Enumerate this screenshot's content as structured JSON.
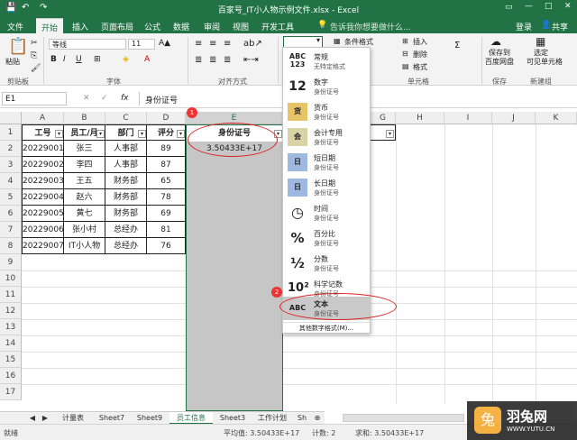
{
  "window": {
    "title": "百家号_IT小人物示例文件.xlsx - Excel"
  },
  "tabs": {
    "file": "文件",
    "home": "开始",
    "insert": "插入",
    "layout": "页面布局",
    "formula": "公式",
    "data": "数据",
    "review": "审阅",
    "view": "视图",
    "dev": "开发工具",
    "tell": "告诉我你想要做什么...",
    "login": "登录",
    "share": "共享"
  },
  "ribbon": {
    "paste": "粘贴",
    "clipboard": "剪贴板",
    "font_name": "等线",
    "font_size": "11",
    "font": "字体",
    "align": "对齐方式",
    "cond_fmt": "条件格式",
    "insert": "插入",
    "delete": "删除",
    "format": "格式",
    "cells": "单元格",
    "save_to": "保存到",
    "baidu": "百度网盘",
    "save": "保存",
    "select": "选定",
    "visible_cells": "可见单元格",
    "new_group": "新建组"
  },
  "formula_bar": {
    "name_box": "E1",
    "fx": "fx",
    "value": "身份证号"
  },
  "columns": [
    "A",
    "B",
    "C",
    "D",
    "E",
    "F",
    "G",
    "H",
    "I",
    "J",
    "K"
  ],
  "rows": [
    "1",
    "2",
    "3",
    "4",
    "5",
    "6",
    "7",
    "8",
    "9",
    "10",
    "11",
    "12",
    "13",
    "14",
    "15",
    "16",
    "17"
  ],
  "table": {
    "headers": [
      "工号",
      "员工/月",
      "部门",
      "评分",
      "身份证号"
    ],
    "data": [
      [
        "20229001",
        "张三",
        "人事部",
        "89",
        "3.50433E+17"
      ],
      [
        "20229002",
        "李四",
        "人事部",
        "87",
        ""
      ],
      [
        "20229003",
        "王五",
        "财务部",
        "65",
        ""
      ],
      [
        "20229004",
        "赵六",
        "财务部",
        "78",
        ""
      ],
      [
        "20229005",
        "黄七",
        "财务部",
        "69",
        ""
      ],
      [
        "20229006",
        "张小村",
        "总经办",
        "81",
        ""
      ],
      [
        "20229007",
        "IT小人物",
        "总经办",
        "76",
        ""
      ]
    ]
  },
  "dropdown": {
    "items": [
      {
        "icon": "ABC 123",
        "name": "常规",
        "sub": "无特定格式"
      },
      {
        "icon": "12",
        "name": "数字",
        "sub": "身份证号"
      },
      {
        "icon": "货",
        "name": "货币",
        "sub": "身份证号"
      },
      {
        "icon": "会",
        "name": "会计专用",
        "sub": "身份证号"
      },
      {
        "icon": "日",
        "name": "短日期",
        "sub": "身份证号"
      },
      {
        "icon": "日",
        "name": "长日期",
        "sub": "身份证号"
      },
      {
        "icon": "◷",
        "name": "时间",
        "sub": "身份证号"
      },
      {
        "icon": "%",
        "name": "百分比",
        "sub": "身份证号"
      },
      {
        "icon": "½",
        "name": "分数",
        "sub": "身份证号"
      },
      {
        "icon": "10²",
        "name": "科学记数",
        "sub": "身份证号"
      },
      {
        "icon": "ABC",
        "name": "文本",
        "sub": "身份证号"
      }
    ],
    "more": "其他数字格式(M)..."
  },
  "badges": {
    "b1": "1",
    "b2": "2"
  },
  "sheets": [
    "计量表",
    "Sheet7",
    "Sheet9",
    "员工信息",
    "Sheet3",
    "工作计划",
    "Sh"
  ],
  "status": {
    "ready": "就绪",
    "avg": "平均值: 3.50433E+17",
    "count": "计数: 2",
    "sum": "求和: 3.50433E+17"
  },
  "watermark": {
    "brand": "羽兔网",
    "url": "WWW.YUTU.CN"
  },
  "colors": {
    "excel_green": "#217346",
    "selection": "#c6c6c6",
    "annotation_red": "#d22222"
  }
}
